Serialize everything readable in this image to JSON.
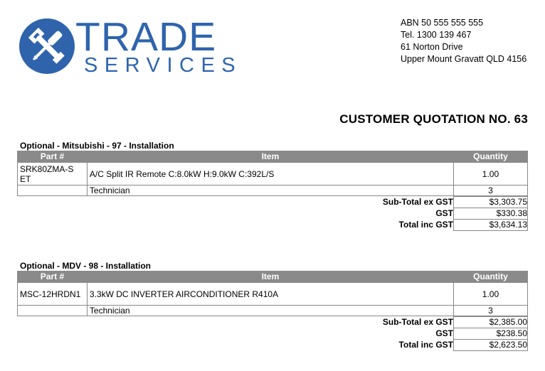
{
  "logo": {
    "icon": "wrench-screwdriver-icon",
    "brand_color": "#2f64ad",
    "word1": "TRADE",
    "word2": "SERVICES"
  },
  "company": {
    "abn": "ABN 50 555 555 555",
    "tel": "Tel. 1300 139 467",
    "address1": "61 Norton Drive",
    "address2": "Upper Mount Gravatt QLD 4156"
  },
  "title": "CUSTOMER QUOTATION NO. 63",
  "table_header": {
    "part": "Part #",
    "item": "Item",
    "qty": "Quantity",
    "header_bg": "#8a8a8a"
  },
  "sections": [
    {
      "title": "Optional - Mitsubishi - 97 - Installation",
      "rows": [
        {
          "part": "SRK80ZMA-SET",
          "item": "A/C Split IR Remote C:8.0kW H:9.0kW C:392L/S",
          "qty": "1.00"
        },
        {
          "part": "",
          "item": "Technician",
          "qty": "3"
        }
      ],
      "totals": [
        {
          "label": "Sub-Total ex GST",
          "value": "$3,303.75"
        },
        {
          "label": "GST",
          "value": "$330.38"
        },
        {
          "label": "Total inc GST",
          "value": "$3,634.13"
        }
      ]
    },
    {
      "title": "Optional - MDV - 98 - Installation",
      "rows": [
        {
          "part": "MSC-12HRDN1",
          "item": "3.3kW DC INVERTER AIRCONDITIONER R410A",
          "qty": "1.00"
        },
        {
          "part": "",
          "item": "Technician",
          "qty": "3"
        }
      ],
      "totals": [
        {
          "label": "Sub-Total ex GST",
          "value": "$2,385.00"
        },
        {
          "label": "GST",
          "value": "$238.50"
        },
        {
          "label": "Total inc GST",
          "value": "$2,623.50"
        }
      ]
    }
  ]
}
